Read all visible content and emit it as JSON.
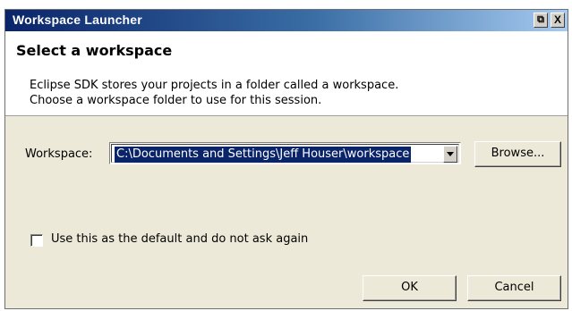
{
  "window": {
    "title": "Workspace Launcher",
    "restore_glyph": "⧉",
    "close_glyph": "X"
  },
  "header": {
    "title": "Select a workspace",
    "description_lines": [
      "Eclipse SDK stores your projects in a folder called a workspace.",
      "Choose a workspace folder to use for this session."
    ]
  },
  "workspace": {
    "label": "Workspace:",
    "value": "C:\\Documents and Settings\\Jeff Houser\\workspace",
    "browse_label": "Browse..."
  },
  "default_checkbox": {
    "label": "Use this as the default and do not ask again",
    "checked": false
  },
  "buttons": {
    "ok_label": "OK",
    "cancel_label": "Cancel"
  },
  "icons": {
    "restore": "restore-icon",
    "close": "close-icon",
    "dropdown": "chevron-down-icon"
  },
  "colors": {
    "title_bar_start": "#0a246a",
    "title_bar_end": "#a6caf0",
    "selection": "#0a246a",
    "dialog_bg": "#ece9d8"
  }
}
